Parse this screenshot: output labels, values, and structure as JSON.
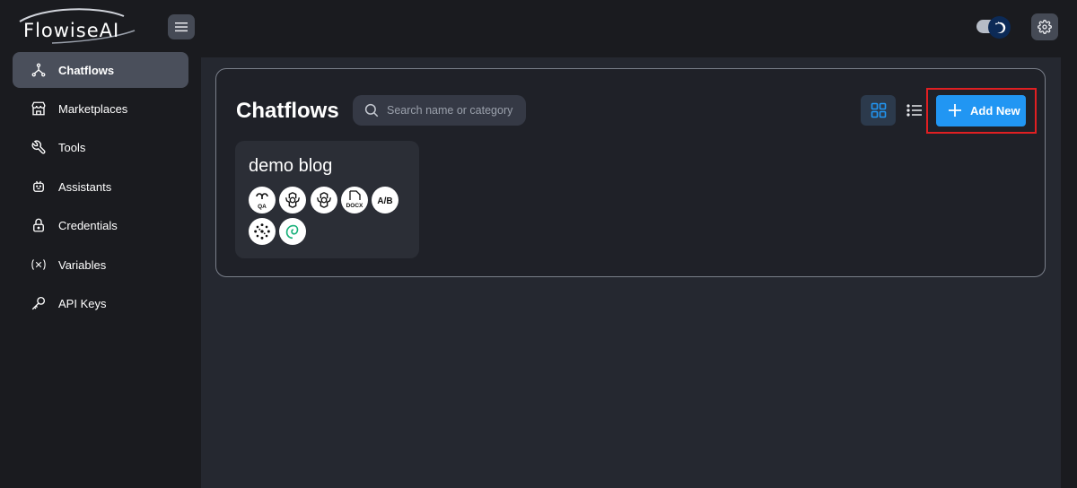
{
  "app": {
    "name": "FlowiseAI"
  },
  "sidebar": {
    "items": [
      {
        "label": "Chatflows",
        "icon": "hierarchy-icon",
        "active": true
      },
      {
        "label": "Marketplaces",
        "icon": "store-icon",
        "active": false
      },
      {
        "label": "Tools",
        "icon": "wrench-icon",
        "active": false
      },
      {
        "label": "Assistants",
        "icon": "robot-icon",
        "active": false
      },
      {
        "label": "Credentials",
        "icon": "lock-icon",
        "active": false
      },
      {
        "label": "Variables",
        "icon": "variable-icon",
        "active": false
      },
      {
        "label": "API Keys",
        "icon": "key-icon",
        "active": false
      }
    ]
  },
  "main": {
    "title": "Chatflows",
    "search": {
      "placeholder": "Search name or category",
      "value": ""
    },
    "add_button_label": "Add New",
    "chatflows": [
      {
        "name": "demo blog",
        "node_icons": [
          {
            "name": "qa-chain-icon",
            "text": "QA"
          },
          {
            "name": "openai-icon",
            "text": ""
          },
          {
            "name": "openai-icon",
            "text": ""
          },
          {
            "name": "docx-icon",
            "text": "DOCX"
          },
          {
            "name": "ab-split-icon",
            "text": "A/B"
          },
          {
            "name": "vector-store-icon",
            "text": ""
          },
          {
            "name": "embeddings-swirl-icon",
            "text": ""
          }
        ]
      }
    ]
  },
  "colors": {
    "accent": "#2196f3",
    "highlight": "#e01f22",
    "background": "#1a1b1f",
    "panel": "#252830"
  }
}
